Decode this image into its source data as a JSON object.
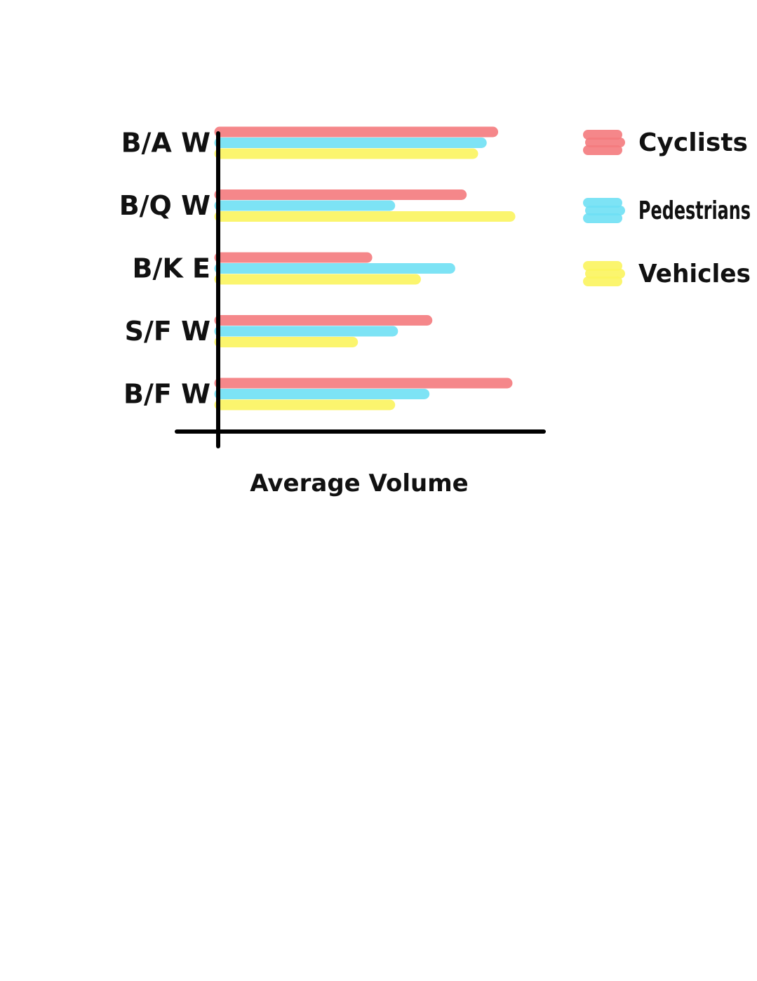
{
  "chart_data": {
    "type": "bar",
    "orientation": "horizontal",
    "categories": [
      "B/A W",
      "B/Q W",
      "B/K E",
      "S/F W",
      "B/F W"
    ],
    "series": [
      {
        "name": "Cyclists",
        "color": "#f47b7e",
        "values": [
          96,
          85,
          52,
          73,
          101
        ]
      },
      {
        "name": "Pedestrians",
        "color": "#6fe0f5",
        "values": [
          92,
          60,
          81,
          61,
          72
        ]
      },
      {
        "name": "Vehicles",
        "color": "#fbf55f",
        "values": [
          89,
          102,
          69,
          47,
          60
        ]
      }
    ],
    "xlabel": "Average Volume",
    "ylabel": "",
    "title": "",
    "xlim": [
      0,
      114
    ],
    "grid": false,
    "legend": "top-right"
  }
}
